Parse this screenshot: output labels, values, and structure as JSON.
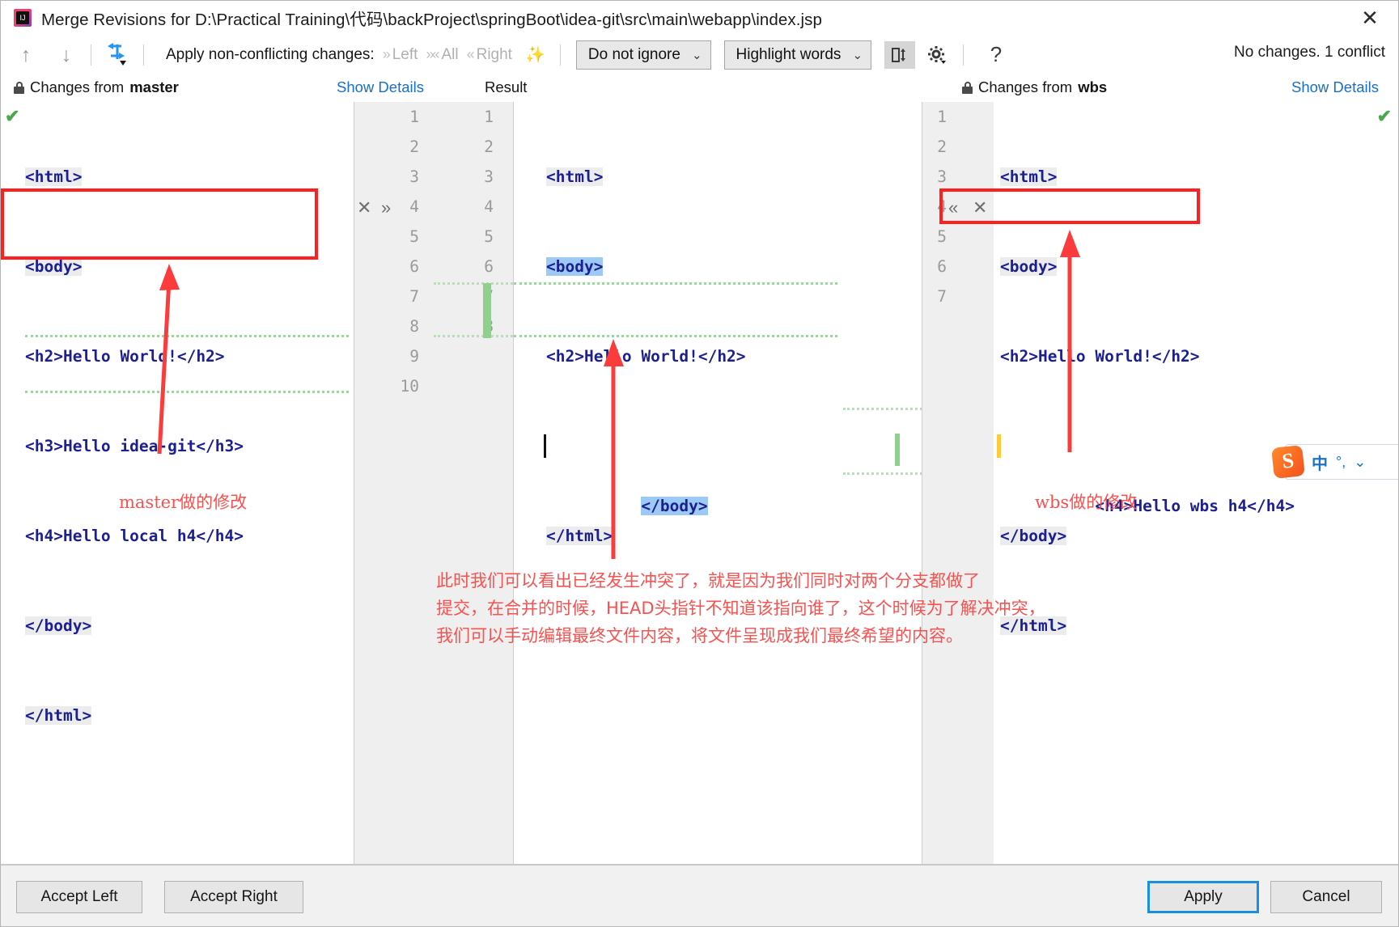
{
  "window": {
    "title": "Merge Revisions for D:\\Practical Training\\代码\\backProject\\springBoot\\idea-git\\src\\main\\webapp\\index.jsp",
    "app_icon": "intellij-idea-icon",
    "close_label": "✕"
  },
  "toolbar": {
    "prev_icon": "arrow-up-icon",
    "next_icon": "arrow-down-icon",
    "magic_merge_icon": "apply-all-non-conflicting-icon",
    "apply_label": "Apply non-conflicting changes:",
    "left_label": "Left",
    "all_label": "All",
    "right_label": "Right",
    "wand_icon": "magic-wand-icon",
    "ignore_select": "Do not ignore",
    "highlight_select": "Highlight words",
    "columns_icon": "editor-layout-icon",
    "settings_icon": "gear-icon",
    "help_icon": "question-mark-icon",
    "status": "No changes. 1 conflict"
  },
  "panel_headers": {
    "left_lock_icon": "lock-icon",
    "left_title_prefix": "Changes from ",
    "left_title_branch": "master",
    "left_show_details": "Show Details",
    "middle_title": "Result",
    "right_lock_icon": "lock-icon",
    "right_title_prefix": "Changes from ",
    "right_title_branch": "wbs",
    "right_show_details": "Show Details"
  },
  "left_pane": {
    "accept_check_icon": "accepted-check-icon",
    "lines": [
      "<html>",
      "<body>",
      "<h2>Hello World!</h2>",
      "<h3>Hello idea-git</h3>",
      "<h4>Hello local h4</h4>",
      "</body>",
      "</html>"
    ]
  },
  "middle_pane": {
    "accept_check_icon": "accepted-check-icon",
    "left_numbers": [
      "1",
      "2",
      "3",
      "4",
      "5",
      "6",
      "7",
      "8",
      "9",
      "10"
    ],
    "right_numbers": [
      "1",
      "2",
      "3",
      "4",
      "5",
      "6",
      "7",
      "8"
    ],
    "conflict_actions": {
      "revert_icon": "x-revert-icon",
      "accept_icon": "chevron-right-accept-icon"
    },
    "lines": [
      "<html>",
      "<body>",
      "<h2>Hello World!</h2>",
      "</body>",
      "</html>"
    ]
  },
  "right_pane": {
    "accept_check_icon": "accepted-check-icon",
    "numbers": [
      "1",
      "2",
      "3",
      "4",
      "5",
      "6",
      "7"
    ],
    "conflict_actions": {
      "accept_icon": "chevron-left-accept-icon",
      "revert_icon": "x-revert-icon"
    },
    "lines": [
      "<html>",
      "<body>",
      "<h2>Hello World!</h2>",
      "<h4>Hello wbs h4</h4>",
      "</body>",
      "</html>"
    ]
  },
  "annotations": {
    "left_label": "master做的修改",
    "right_label": "wbs做的修改",
    "note_line1": "此时我们可以看出已经发生冲突了，就是因为我们同时对两个分支都做了",
    "note_line2": "提交，在合并的时候，HEAD头指针不知道该指向谁了，这个时候为了解决冲突，",
    "note_line3": "我们可以手动编辑最终文件内容，将文件呈现成我们最终希望的内容。"
  },
  "ime": {
    "logo_text": "S",
    "mode": "中",
    "punct": "°,"
  },
  "footer": {
    "accept_left": "Accept Left",
    "accept_right": "Accept Right",
    "apply": "Apply",
    "cancel": "Cancel"
  },
  "colors": {
    "accent_blue": "#1a8fe0",
    "link_blue": "#1a6fc4",
    "conflict_yellow": "#ffe08a",
    "annotation_red": "#f9514f",
    "tag_navy": "#1b1f8f",
    "added_green": "#8fd08f"
  }
}
